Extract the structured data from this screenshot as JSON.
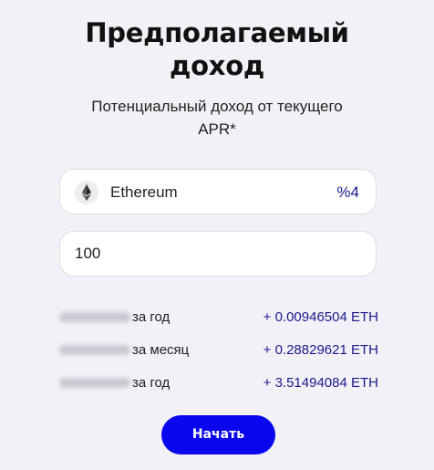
{
  "header": {
    "title_line1": "Предполагаемый",
    "title_line2": "доход",
    "subtitle_line1": "Потенциальный доход от текущего",
    "subtitle_line2": "APR*"
  },
  "asset_select": {
    "icon": "ethereum-icon",
    "name": "Ethereum",
    "rate": "%4"
  },
  "amount_input": {
    "value": "100"
  },
  "earnings": [
    {
      "period": "за год",
      "value": "+ 0.00946504 ETH"
    },
    {
      "period": "за месяц",
      "value": "+ 0.28829621 ETH"
    },
    {
      "period": "за год",
      "value": "+ 3.51494084 ETH"
    }
  ],
  "start_button": {
    "label": "Начать"
  },
  "colors": {
    "background": "#f2f1f7",
    "accent": "#0a07ee",
    "value_text": "#1a1a8c"
  }
}
